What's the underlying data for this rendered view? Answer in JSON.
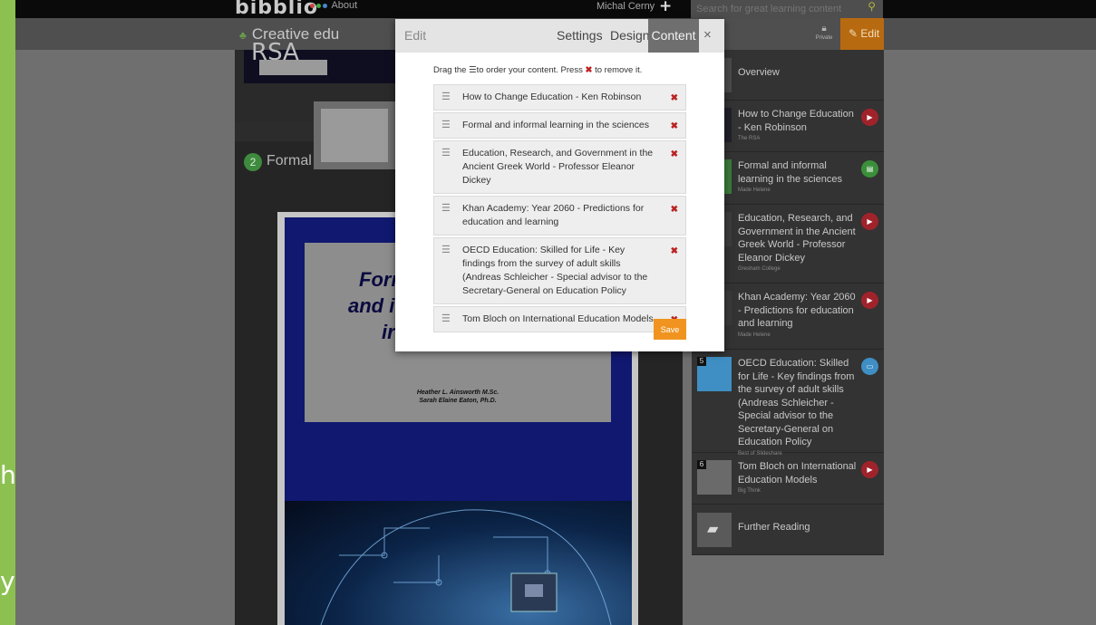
{
  "app": {
    "logo": "bibblio",
    "about": "About",
    "user": "Michal Cerny",
    "plus": "+",
    "search_placeholder": "Search for great learning content",
    "collection_title": "Creative edu",
    "privacy": "Private",
    "edit_button": "Edit"
  },
  "background": {
    "green_char_1": "h",
    "green_char_2": "y",
    "card_title": "Formal a",
    "card_number": "2",
    "rsa_text": "RSA",
    "doc_title_1": "Forı",
    "doc_title_2": "and i",
    "doc_title_3": "ir",
    "doc_author_1": "Heather L. Ainsworth M.Sc.",
    "doc_author_2": "Sarah Elaine Eaton, Ph.D."
  },
  "sidebar": [
    {
      "title": "Overview",
      "source": "",
      "icon": "",
      "num": ""
    },
    {
      "title": "How to Change Education - Ken Robinson",
      "source": "The RSA",
      "icon": "video",
      "num": ""
    },
    {
      "title": "Formal and informal learning in the sciences",
      "source": "Made Helene",
      "icon": "slides",
      "num": ""
    },
    {
      "title": "Education, Research, and Government in the Ancient Greek World - Professor Eleanor Dickey",
      "source": "Gresham College",
      "icon": "video",
      "num": ""
    },
    {
      "title": "Khan Academy: Year 2060 - Predictions for education and learning",
      "source": "Made Helene",
      "icon": "video",
      "num": ""
    },
    {
      "title": "OECD Education: Skilled for Life - Key findings from the survey of adult skills (Andreas Schleicher - Special advisor to the Secretary-General on Education Policy",
      "source": "Best of Slideshare",
      "icon": "discussion",
      "num": "5"
    },
    {
      "title": "Tom Bloch on International Education Models",
      "source": "Big Think",
      "icon": "video",
      "num": "6"
    },
    {
      "title": "Further Reading",
      "source": "",
      "icon": "",
      "num": ""
    }
  ],
  "modal": {
    "edit_label": "Edit",
    "tabs": [
      "Settings",
      "Design",
      "Content"
    ],
    "active_tab": "Content",
    "close": "×",
    "instructions_pre": "Drag the",
    "instructions_mid": "to order your content. Press",
    "instructions_post": "to remove it.",
    "items": [
      "How to Change Education - Ken Robinson",
      "Formal and informal learning in the sciences",
      "Education, Research, and Government in the Ancient Greek World - Professor Eleanor Dickey",
      "Khan Academy: Year 2060 - Predictions for education and learning",
      "OECD Education: Skilled for Life - Key findings from the survey of adult skills (Andreas Schleicher - Special advisor to the Secretary-General on Education Policy",
      "Tom Bloch on International Education Models"
    ],
    "save": "Save"
  },
  "colors": {
    "accent_orange": "#f0941f",
    "edit_orange": "#b86a10",
    "remove_red": "#b22222",
    "page_green": "#8cc152"
  }
}
